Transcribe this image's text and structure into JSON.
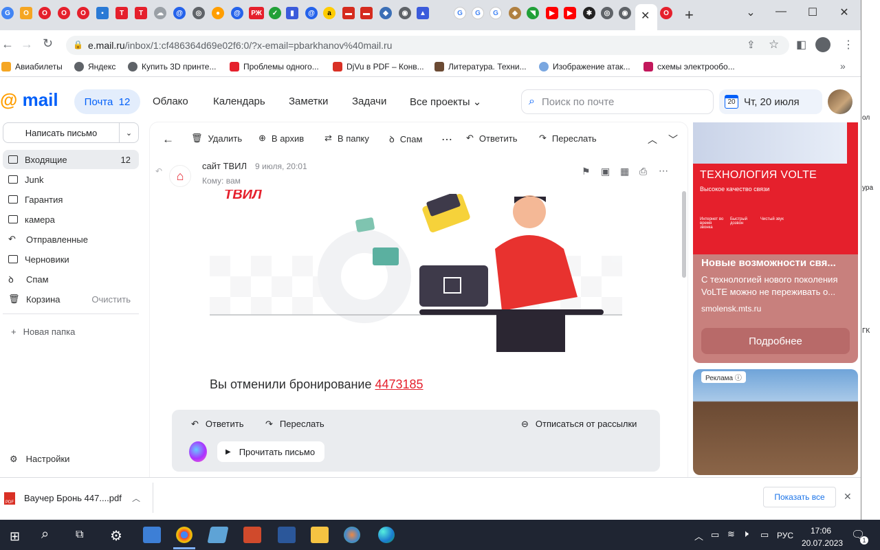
{
  "browser": {
    "url_domain": "e.mail.ru",
    "url_path": "/inbox/1:cf486364d69e02f6:0/?x-email=pbarkhanov%40mail.ru",
    "bookmarks": [
      "Авиабилеты",
      "Яндекс",
      "Купить 3D принте...",
      "Проблемы одного...",
      "DjVu в PDF – Конв...",
      "Литература. Техни...",
      "Изображение атак...",
      "схемы электрообо..."
    ]
  },
  "mail": {
    "logo": "mail",
    "nav": {
      "inbox_label": "Почта",
      "inbox_count": "12",
      "cloud": "Облако",
      "calendar": "Календарь",
      "notes": "Заметки",
      "tasks": "Задачи",
      "all_projects": "Все проекты"
    },
    "search_placeholder": "Поиск по почте",
    "date_day": "20",
    "date_label": "Чт, 20 июля",
    "compose": "Написать письмо",
    "folders": [
      {
        "label": "Входящие",
        "count": "12"
      },
      {
        "label": "Junk",
        "count": ""
      },
      {
        "label": "Гарантия",
        "count": ""
      },
      {
        "label": "камера",
        "count": ""
      },
      {
        "label": "Отправленные",
        "count": ""
      },
      {
        "label": "Черновики",
        "count": ""
      },
      {
        "label": "Спам",
        "count": ""
      },
      {
        "label": "Корзина",
        "count": "Очистить"
      }
    ],
    "new_folder": "Новая папка",
    "settings": "Настройки"
  },
  "letter": {
    "toolbar": {
      "delete": "Удалить",
      "archive": "В архив",
      "to_folder": "В папку",
      "spam": "Спам",
      "reply": "Ответить",
      "forward": "Переслать"
    },
    "sender": "сайт ТВИЛ",
    "date": "9 июля, 20:01",
    "to": "Кому: вам",
    "brand_fragment": "ТВИЛ",
    "body_text": "Вы отменили бронирование",
    "booking_link": "4473185",
    "footer": {
      "reply": "Ответить",
      "forward": "Переслать",
      "unsubscribe": "Отписаться от рассылки",
      "read_letter": "Прочитать письмо"
    }
  },
  "ads": {
    "ad1_banner_title": "ТЕХНОЛОГИЯ VOLTE",
    "ad1_banner_sub": "Высокое качество связи",
    "ad1_features": [
      "Интернет во время звонка",
      "Быстрый дозвон",
      "Чистый звук"
    ],
    "ad1_title": "Новые возможности свя...",
    "ad1_text": "С технологией нового поколения VoLTE можно не переживать о...",
    "ad1_domain": "smolensk.mts.ru",
    "ad1_button": "Подробнее",
    "ad2_label": "Реклама"
  },
  "downloads": {
    "file": "Ваучер Бронь 447....pdf",
    "show_all": "Показать все"
  },
  "taskbar": {
    "time": "17:06",
    "date": "20.07.2023",
    "lang": "РУС",
    "notifications": "1"
  },
  "right_strip": [
    "ол",
    "ура",
    "ГК"
  ]
}
